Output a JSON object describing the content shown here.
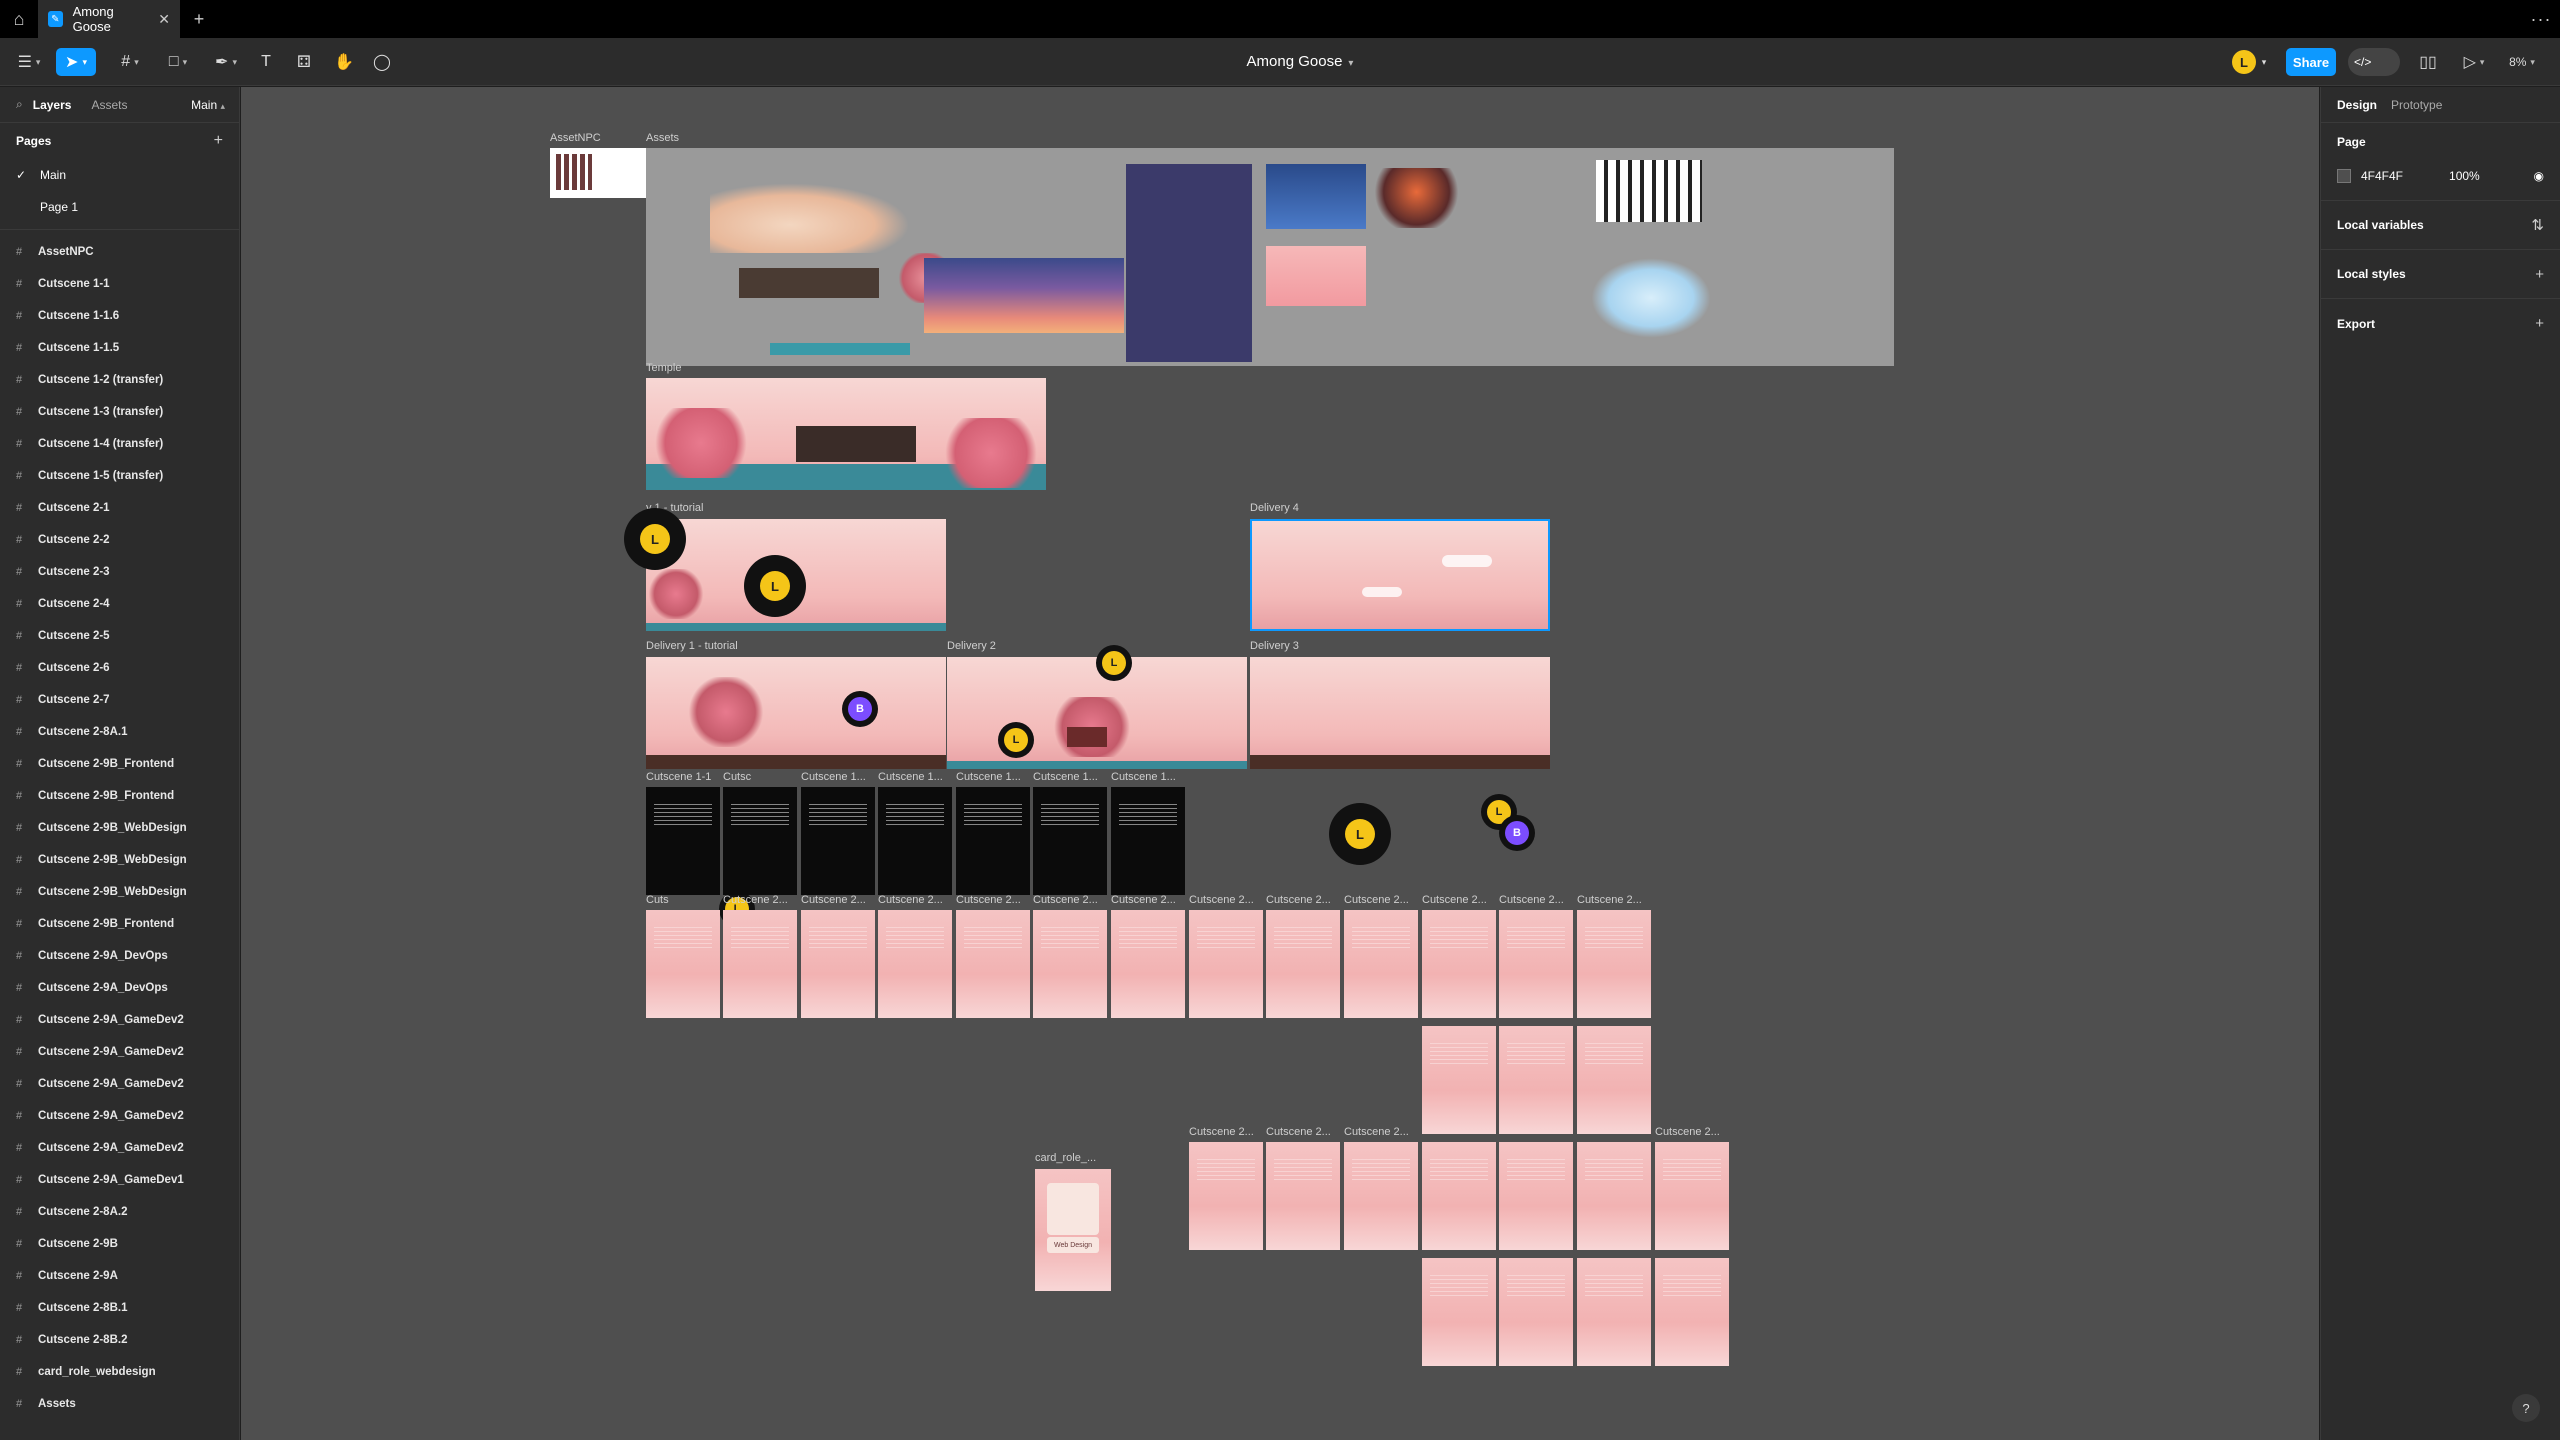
{
  "tabbar": {
    "tab_title": "Among Goose",
    "home_icon": "home-icon",
    "close_icon": "close-icon",
    "new_tab": "+",
    "more": "···"
  },
  "toolbar": {
    "doc_title": "Among Goose",
    "share_label": "Share",
    "zoom": "8%",
    "avatar_initial": "L",
    "accent": "#0d99ff"
  },
  "left": {
    "tabs": {
      "layers": "Layers",
      "assets": "Assets",
      "page_selector": "Main"
    },
    "pages_heading": "Pages",
    "pages": [
      {
        "label": "Main",
        "current": true
      },
      {
        "label": "Page 1",
        "current": false
      }
    ],
    "layers": [
      "AssetNPC",
      "Cutscene 1-1",
      "Cutscene 1-1.6",
      "Cutscene 1-1.5",
      "Cutscene 1-2 (transfer)",
      "Cutscene 1-3 (transfer)",
      "Cutscene 1-4 (transfer)",
      "Cutscene 1-5 (transfer)",
      "Cutscene 2-1",
      "Cutscene 2-2",
      "Cutscene 2-3",
      "Cutscene 2-4",
      "Cutscene 2-5",
      "Cutscene 2-6",
      "Cutscene 2-7",
      "Cutscene 2-8A.1",
      "Cutscene 2-9B_Frontend",
      "Cutscene 2-9B_Frontend",
      "Cutscene 2-9B_WebDesign",
      "Cutscene 2-9B_WebDesign",
      "Cutscene 2-9B_WebDesign",
      "Cutscene 2-9B_Frontend",
      "Cutscene 2-9A_DevOps",
      "Cutscene 2-9A_DevOps",
      "Cutscene 2-9A_GameDev2",
      "Cutscene 2-9A_GameDev2",
      "Cutscene 2-9A_GameDev2",
      "Cutscene 2-9A_GameDev2",
      "Cutscene 2-9A_GameDev2",
      "Cutscene 2-9A_GameDev1",
      "Cutscene 2-8A.2",
      "Cutscene 2-9B",
      "Cutscene 2-9A",
      "Cutscene 2-8B.1",
      "Cutscene 2-8B.2",
      "card_role_webdesign",
      "Assets"
    ]
  },
  "canvas": {
    "bg": "#4f4f4f",
    "labels": {
      "assetnpc": "AssetNPC",
      "assets": "Assets",
      "temple": "Temple",
      "delivery_tutorial_top": "y 1 - tutorial",
      "delivery4": "Delivery 4",
      "delivery1_tutorial": "Delivery 1 - tutorial",
      "delivery2": "Delivery 2",
      "delivery3": "Delivery 3",
      "cutscene_1_1": "Cutscene 1-1",
      "cutscene_short": "Cutsc",
      "cutscene_1_dots": "Cutscene 1...",
      "cutscene_2_dots": "Cutscene 2...",
      "cutscene_2_short": "Cuts",
      "card_role": "card_role_..."
    },
    "card_role_text": "Web Design",
    "cursor_initial_l": "L",
    "cursor_initial_b": "B"
  },
  "right": {
    "tabs": {
      "design": "Design",
      "prototype": "Prototype"
    },
    "page_heading": "Page",
    "page_fill_hex": "4F4F4F",
    "page_fill_opacity": "100%",
    "sections": [
      "Local variables",
      "Local styles",
      "Export"
    ],
    "help": "?"
  }
}
